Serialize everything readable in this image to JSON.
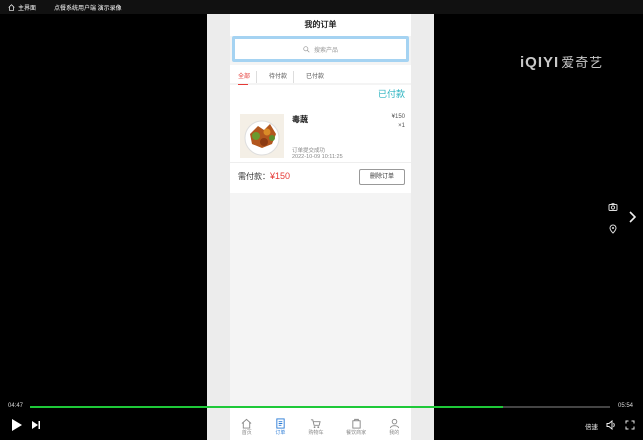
{
  "topbar": {
    "home": "主界面",
    "video_title": "点餐系统用户端 演示录像"
  },
  "app": {
    "header_title": "我的订单",
    "search_placeholder": "搜索产品",
    "tabs": [
      {
        "label": "全部",
        "active": true
      },
      {
        "label": "待付款",
        "active": false
      },
      {
        "label": "已付款",
        "active": false
      }
    ],
    "order": {
      "status": "已付款",
      "product_name": "毒蔬",
      "price": "¥150",
      "qty": "×1",
      "order_text": "订单提交成功",
      "order_time": "2022-10-09 10:11:25",
      "pay_label": "需付款：",
      "pay_amount": "¥150",
      "delete_label": "删除订单"
    },
    "nav": [
      {
        "label": "首页",
        "icon": "home-icon",
        "active": false
      },
      {
        "label": "订单",
        "icon": "order-icon",
        "active": true
      },
      {
        "label": "购物车",
        "icon": "cart-icon",
        "active": false
      },
      {
        "label": "餐饮商家",
        "icon": "shop-icon",
        "active": false
      },
      {
        "label": "我的",
        "icon": "user-icon",
        "active": false
      }
    ]
  },
  "player": {
    "logo_latin": "iQIYI",
    "logo_cn": "爱奇艺",
    "time_current": "04:47",
    "time_total": "05:54",
    "progress_fraction": 0.815,
    "speed_label": "倍速",
    "accent_color": "#1ec938"
  }
}
